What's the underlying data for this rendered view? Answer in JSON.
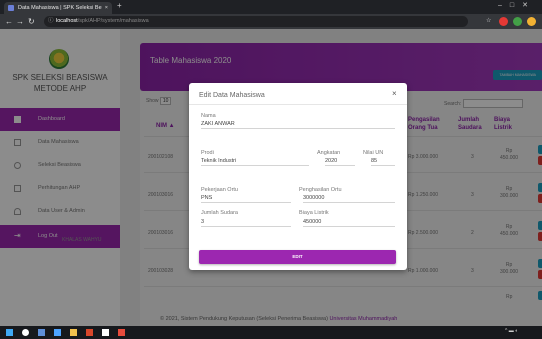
{
  "browser": {
    "tab_title": "Data Mahasiswa | SPK Seleksi Be",
    "tab_close": "×",
    "new_tab": "+",
    "url_host": "localhost",
    "url_path": "/spk/AHP/system/mahasiswa"
  },
  "sidebar": {
    "brand_line1": "SPK SELEKSI BEASISWA",
    "brand_line2": "METODE AHP",
    "items": [
      {
        "label": "Dashboard"
      },
      {
        "label": "Data Mahasiswa"
      },
      {
        "label": "Seleksi Beasiswa"
      },
      {
        "label": "Perhitungan AHP"
      },
      {
        "label": "Data User & Admin"
      },
      {
        "label": "Log Out"
      }
    ]
  },
  "header": {
    "title": "Table Mahasiswa 2020",
    "add_button": "TAMBAH MAHASISWA"
  },
  "table": {
    "show_label": "Show",
    "show_value": "10",
    "search_label": "Search:",
    "columns": {
      "nim": "NIM",
      "pengasilan_line1": "Pengasilan",
      "pengasilan_line2": "Orang Tua",
      "jumlah_line1": "Jumlah",
      "jumlah_line2": "Saudara",
      "biaya_line1": "Biaya",
      "biaya_line2": "Listrik"
    },
    "rows": [
      {
        "nim": "200102108",
        "penghasilan": "Rp 3.000.000",
        "jumlah": "3",
        "biaya_rp": "Rp",
        "biaya_val": "450.000"
      },
      {
        "nim": "200103016",
        "penghasilan": "Rp 1.250.000",
        "jumlah": "3",
        "biaya_rp": "Rp",
        "biaya_val": "300.000"
      },
      {
        "nim": "200103016",
        "penghasilan": "Rp 2.500.000",
        "jumlah": "2",
        "biaya_rp": "Rp",
        "biaya_val": "450.000"
      },
      {
        "nim": "200103028",
        "penghasilan": "Rp 1.000.000",
        "jumlah": "3",
        "biaya_rp": "Rp",
        "biaya_val": "300.000"
      }
    ],
    "ghost_name": "KHALAS WAHYU",
    "last_rp": "Rp"
  },
  "modal": {
    "title": "Edit Data Mahasiswa",
    "close": "×",
    "fields": {
      "nama_label": "Nama",
      "nama_value": "ZAKI ANWAR",
      "prodi_label": "Prodi",
      "prodi_value": "Teknik Industri",
      "angkatan_label": "Angkatan",
      "angkatan_value": "2020",
      "nilai_label": "Nilai UN",
      "nilai_value": "85",
      "pekerjaan_label": "Pekerjaan Ortu",
      "pekerjaan_value": "PNS",
      "penghasilan_label": "Penghasilan Ortu",
      "penghasilan_value": "3000000",
      "saudara_label": "Jumlah Sudara",
      "saudara_value": "3",
      "listrik_label": "Biaya Listrik",
      "listrik_value": "450000"
    },
    "submit": "EDIT"
  },
  "footer": {
    "text": "© 2021, Sistem Pendukung Keputusan (Seleksi Penerima Beasiswa)",
    "link": "Universitas Muhammadiyah"
  },
  "colors": {
    "primary": "#9c27b0",
    "info": "#1da1c4",
    "danger": "#e53935"
  }
}
